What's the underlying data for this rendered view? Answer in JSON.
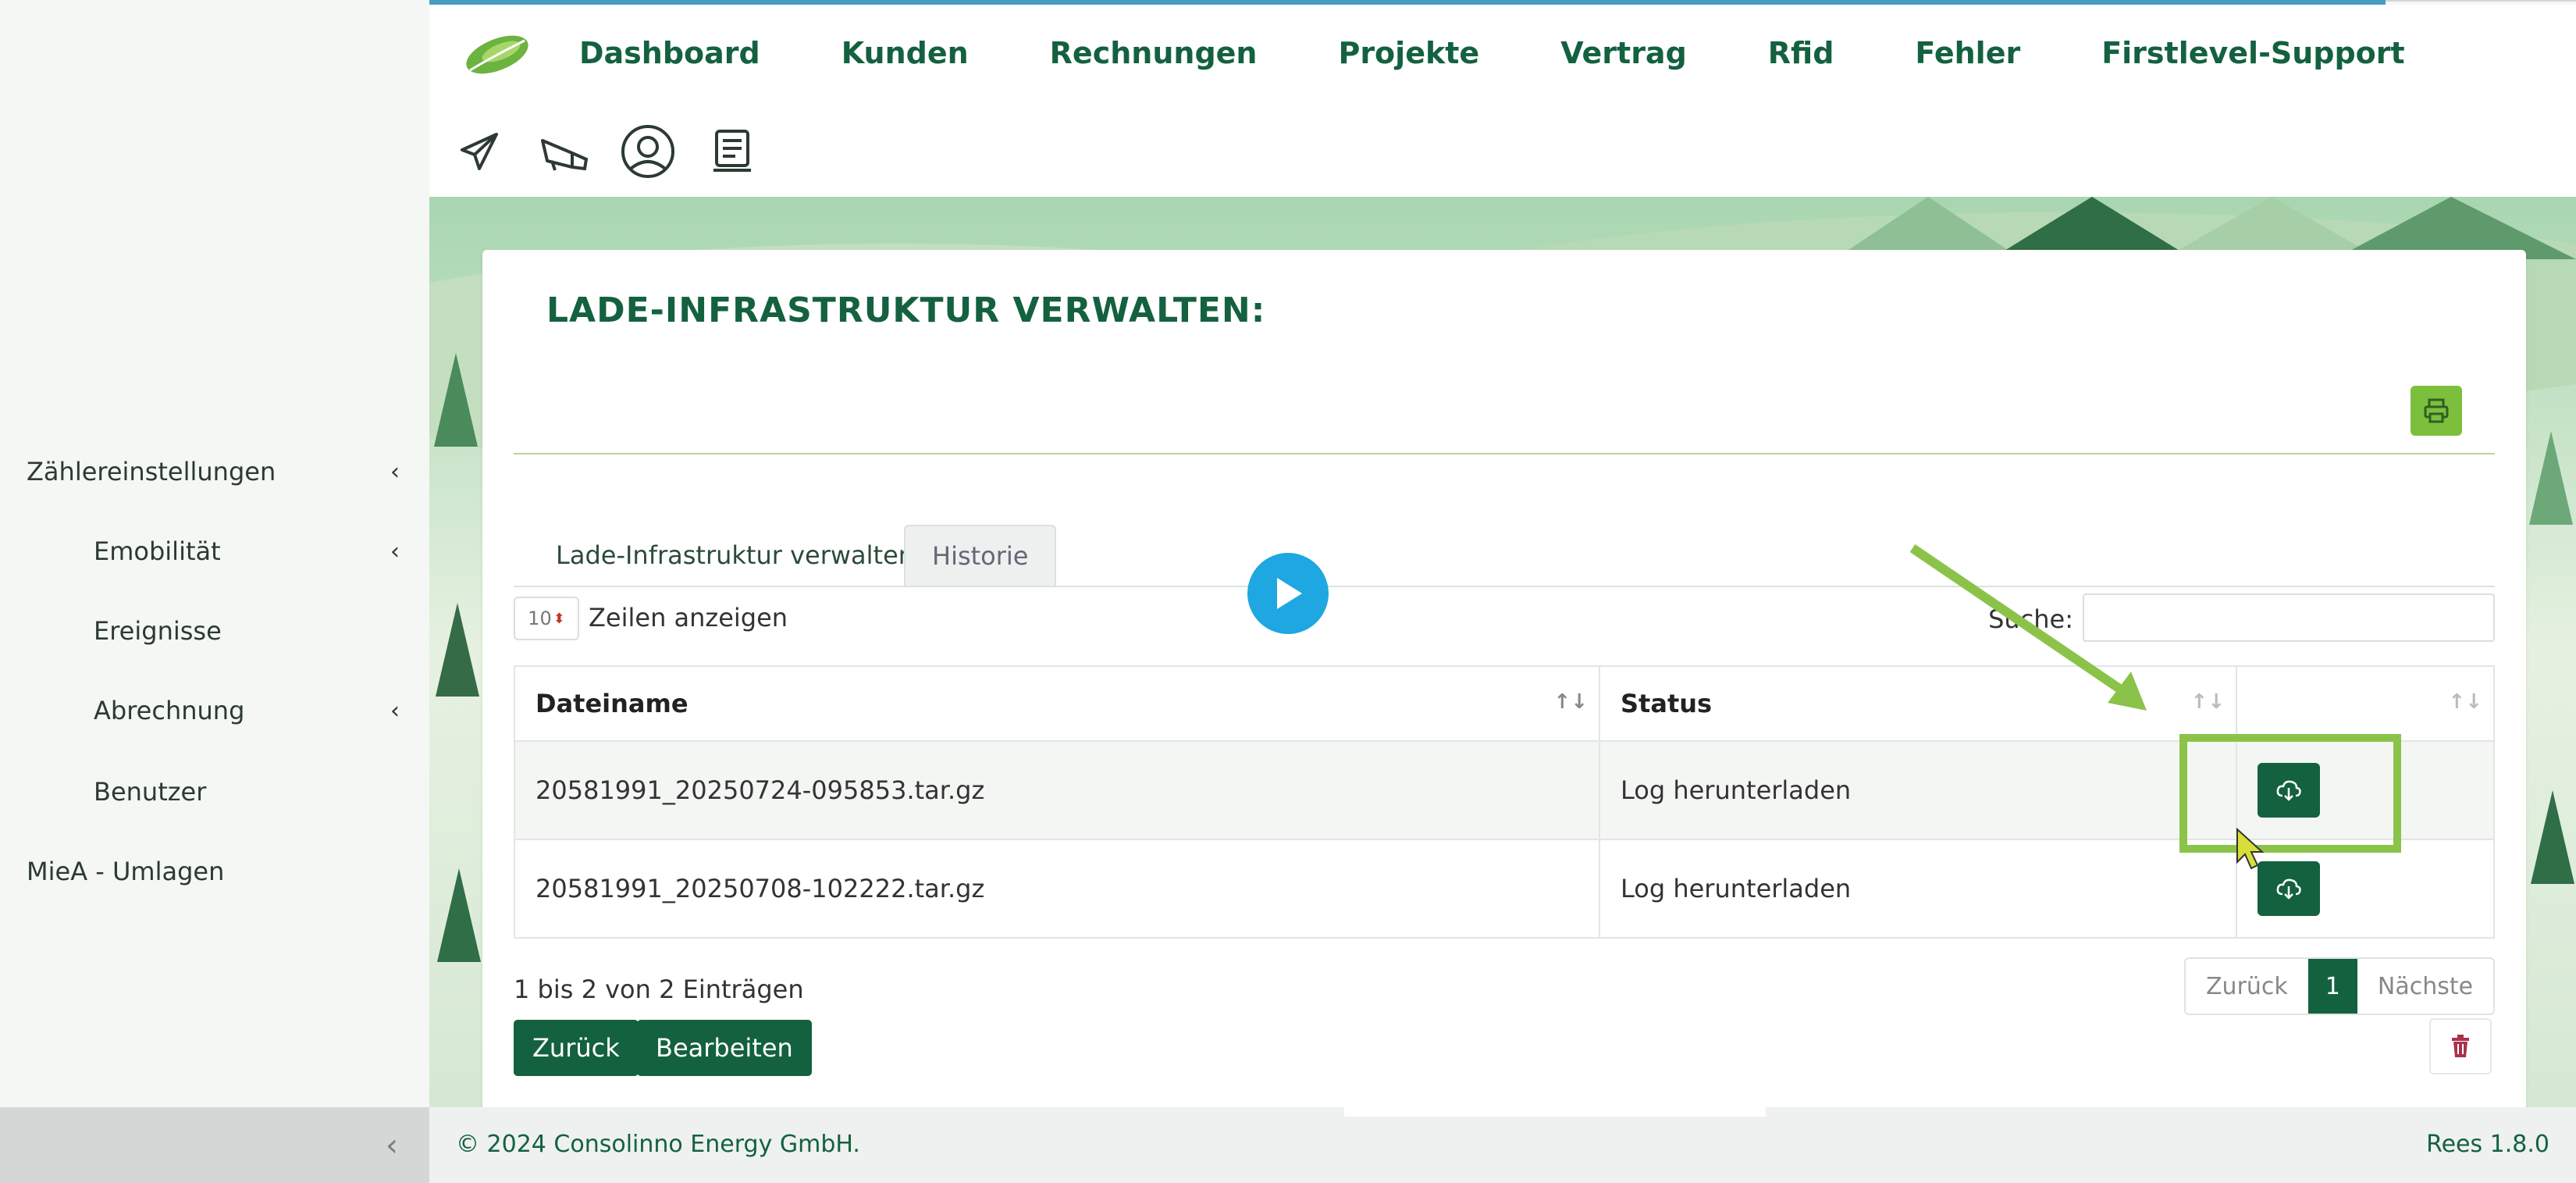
{
  "nav": {
    "items": [
      "Dashboard",
      "Kunden",
      "Rechnungen",
      "Projekte",
      "Vertrag",
      "Rfid",
      "Fehler",
      "Firstlevel-Support"
    ]
  },
  "toolbar_icons": [
    "paper-plane-icon",
    "megaphone-icon",
    "support-agent-icon",
    "invoice-icon"
  ],
  "sidebar": {
    "items": [
      {
        "label": "Zählereinstellungen",
        "chevron": "‹"
      },
      {
        "label": "Emobilität",
        "chevron": "‹"
      },
      {
        "label": "Ereignisse",
        "chevron": ""
      },
      {
        "label": "Abrechnung",
        "chevron": "‹"
      },
      {
        "label": "Benutzer",
        "chevron": ""
      },
      {
        "label": "MieA - Umlagen",
        "chevron": ""
      }
    ],
    "collapse": "‹"
  },
  "card": {
    "title": "LADE-INFRASTRUKTUR VERWALTEN:"
  },
  "tabs": [
    "Lade-Infrastruktur verwalten",
    "Historie"
  ],
  "table_controls": {
    "length_value": "10",
    "length_label": "Zeilen anzeigen",
    "search_label": "Suche:",
    "search_value": ""
  },
  "table": {
    "columns": [
      "Dateiname",
      "Status",
      ""
    ],
    "rows": [
      {
        "file": "20581991_20250724-095853.tar.gz",
        "status": "Log herunterladen"
      },
      {
        "file": "20581991_20250708-102222.tar.gz",
        "status": "Log herunterladen"
      }
    ]
  },
  "info": "1 bis 2 von 2 Einträgen",
  "pager": {
    "prev": "Zurück",
    "current": "1",
    "next": "Nächste"
  },
  "buttons": {
    "back": "Zurück",
    "edit": "Bearbeiten"
  },
  "footer": {
    "copyright": "© 2024 Consolinno Energy GmbH.",
    "version": "Rees 1.8.0"
  },
  "colors": {
    "brand_green": "#14613f",
    "accent_lime": "#8bc34a",
    "play_blue": "#1ea7e1"
  }
}
